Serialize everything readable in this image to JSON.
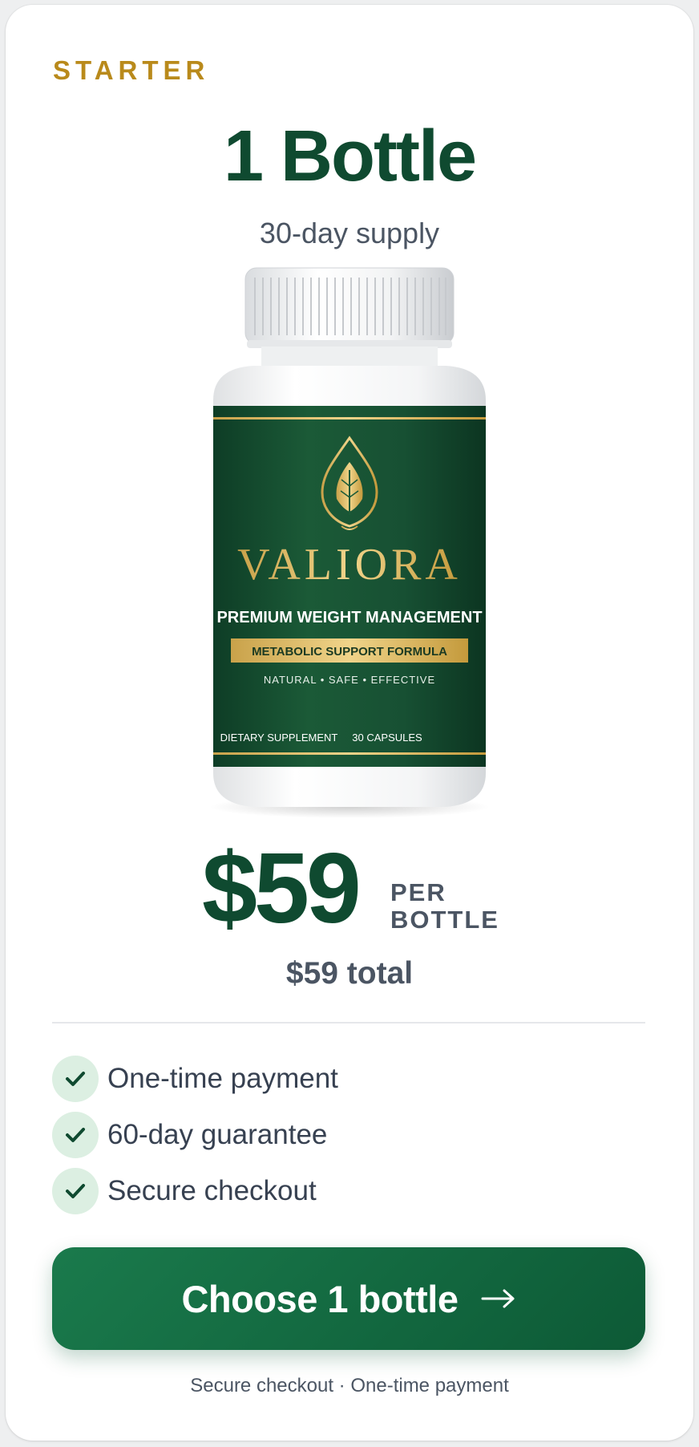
{
  "offer": {
    "tier_label": "STARTER",
    "title": "1 Bottle",
    "subtitle": "30-day supply"
  },
  "product": {
    "brand": "VALIORA",
    "name": "PREMIUM WEIGHT MANAGEMENT",
    "formula": "METABOLIC SUPPORT FORMULA",
    "claims": "NATURAL • SAFE • EFFECTIVE",
    "type": "DIETARY SUPPLEMENT",
    "count": "30 CAPSULES",
    "icon": "leaf-icon"
  },
  "pricing": {
    "price": "$59",
    "per_line1": "PER",
    "per_line2": "BOTTLE",
    "total": "$59 total"
  },
  "features": [
    {
      "label": "One-time payment",
      "icon": "check-icon"
    },
    {
      "label": "60-day guarantee",
      "icon": "check-icon"
    },
    {
      "label": "Secure checkout",
      "icon": "check-icon"
    }
  ],
  "cta": {
    "label": "Choose 1 bottle",
    "icon": "arrow-right-icon"
  },
  "footnote": "Secure checkout · One-time payment",
  "colors": {
    "brand_green": "#0f4a30",
    "accent_gold": "#b98a1b",
    "button_green": "#1a7a4c",
    "check_bg": "#dcefe2",
    "label_green": "#1b5a37"
  }
}
